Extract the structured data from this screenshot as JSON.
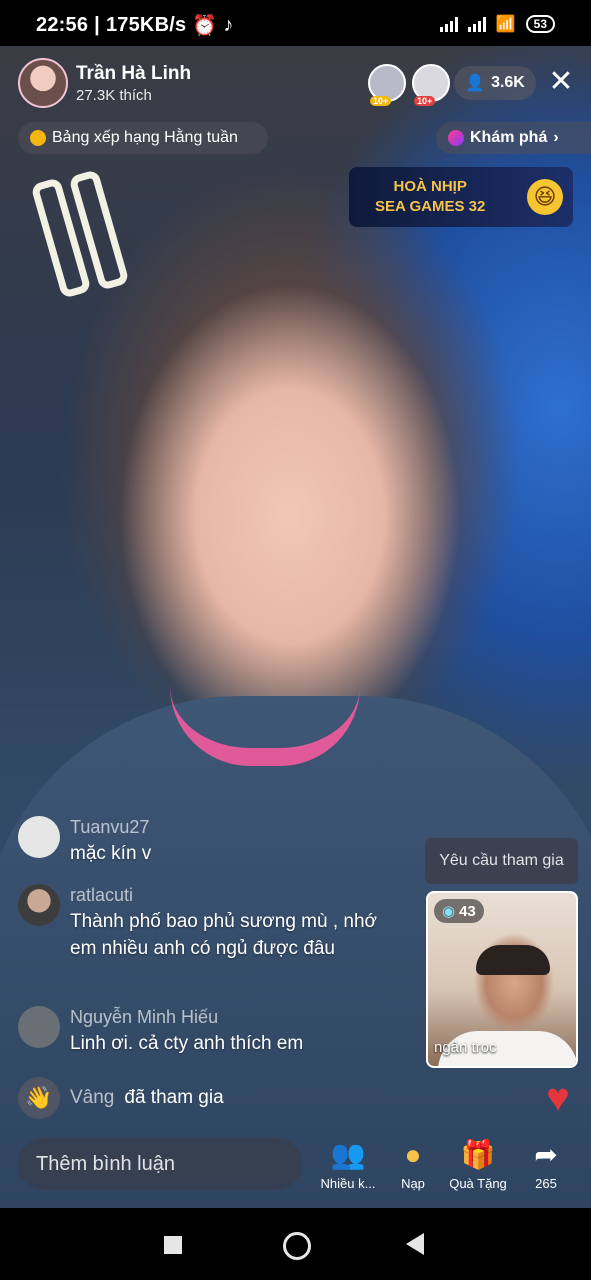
{
  "status_bar": {
    "time": "22:56",
    "net_speed": "175KB/s",
    "battery": "53"
  },
  "host": {
    "name": "Trần Hà Linh",
    "likes": "27.3K thích"
  },
  "viewers": {
    "badge1": "10+",
    "badge2": "10+",
    "count": "3.6K"
  },
  "ranking_label": "Bảng xếp hạng Hằng tuần",
  "explore_label": "Khám phá",
  "banner": {
    "line1": "HOÀ NHỊP",
    "line2": "SEA GAMES 32"
  },
  "comments": [
    {
      "user": "Tuanvu27",
      "text": "mặc kín v"
    },
    {
      "user": "ratlacuti",
      "text": "Thành phố bao phủ sương mù , nhớ em nhiều anh có ngủ được đâu"
    },
    {
      "user": "Nguyễn Minh Hiếu",
      "text": "Linh ơi. cả cty anh thích em"
    }
  ],
  "join_notice": {
    "user": "Vâng",
    "text": "đã tham gia"
  },
  "guest": {
    "request_label": "Yêu cầu tham gia",
    "score": "43",
    "name": "ngân troc"
  },
  "comment_placeholder": "Thêm bình luận",
  "actions": [
    {
      "label": "Nhiều k...",
      "icon": "multi-guest-icon"
    },
    {
      "label": "Nạp",
      "icon": "recharge-coin-icon"
    },
    {
      "label": "Quà Tặng",
      "icon": "gift-icon"
    },
    {
      "label": "265",
      "icon": "share-icon"
    }
  ],
  "colors": {
    "heart": "#e5353d",
    "gift": "#ff4d7a",
    "accent": "#f6c24a"
  }
}
